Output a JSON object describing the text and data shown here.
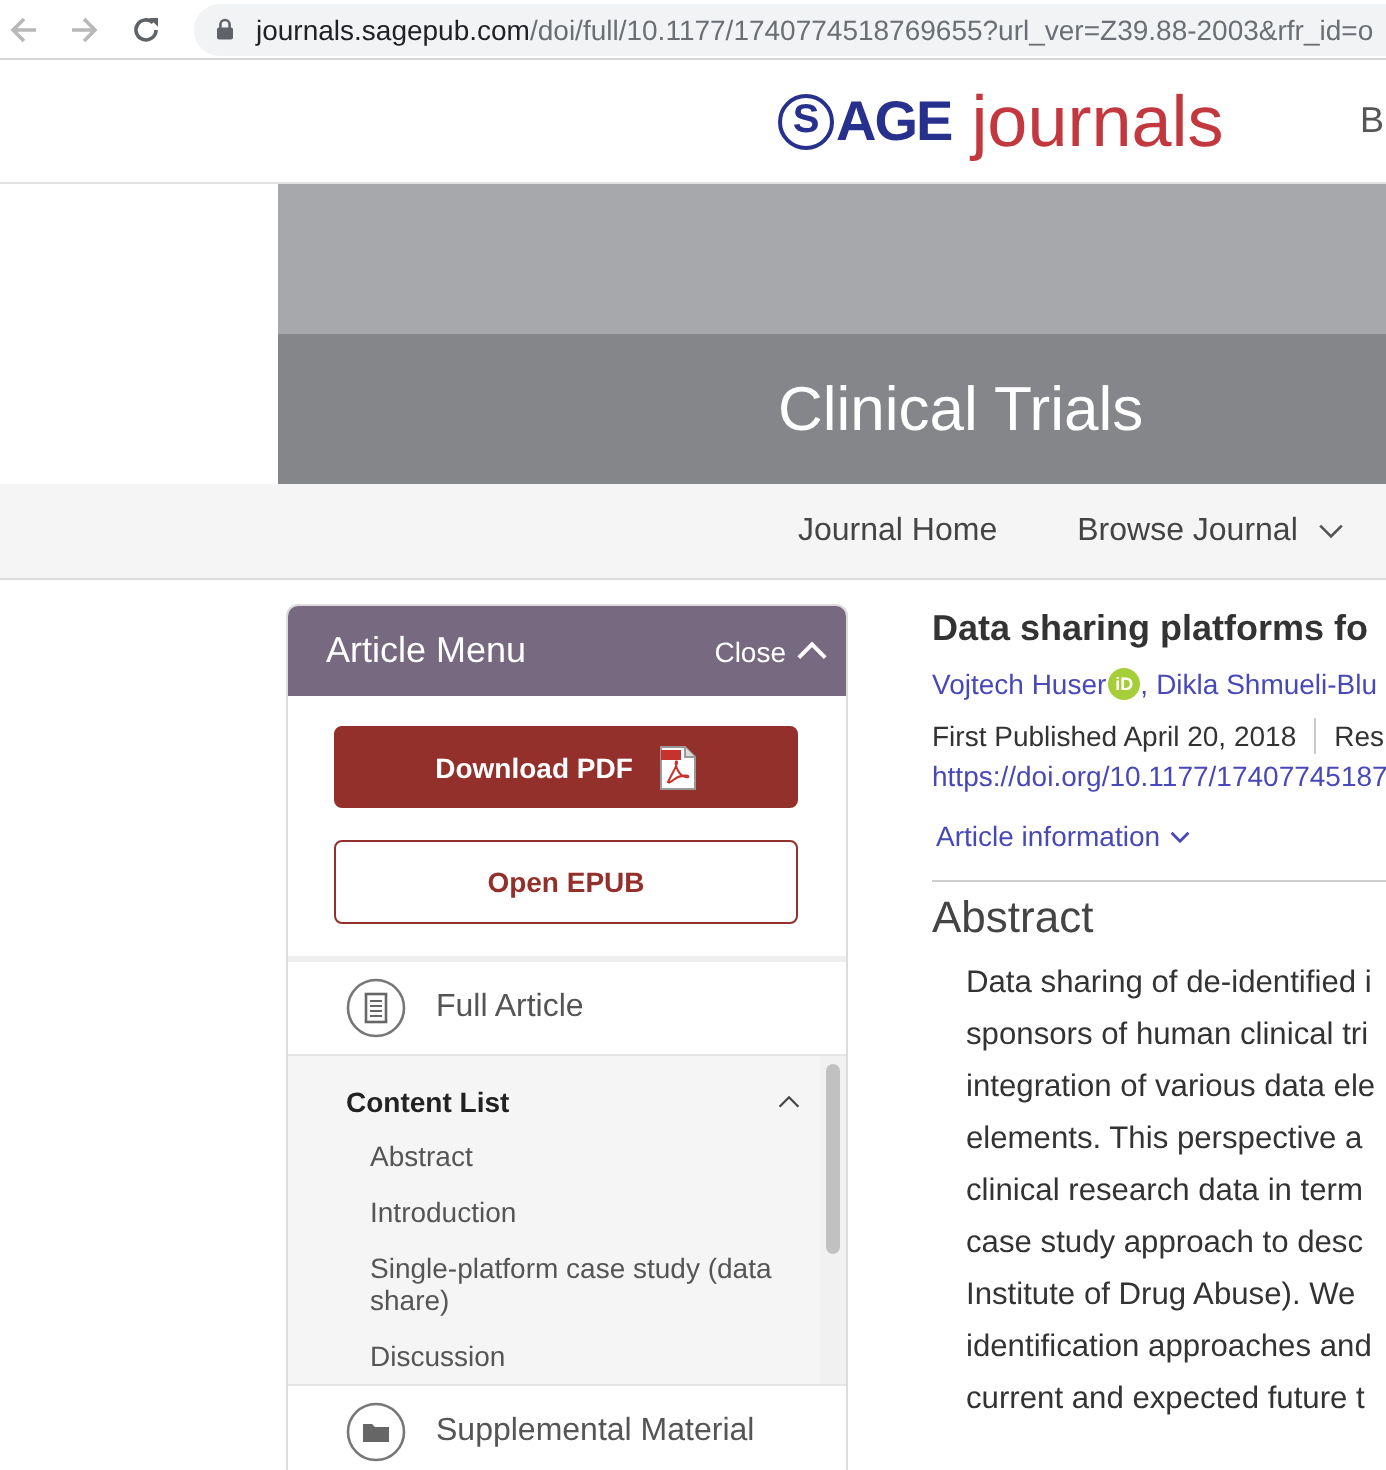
{
  "browser": {
    "back_disabled": true,
    "forward_disabled": true,
    "host": "journals.sagepub.com",
    "path": "/doi/full/10.1177/1740774518769655?url_ver=Z39.88-2003&rfr_id=o"
  },
  "header": {
    "logo": {
      "letter": "S",
      "rest": "AGE",
      "product": "journals"
    },
    "nav_cut": "B"
  },
  "banner": {
    "title": "Clinical Trials"
  },
  "journal_nav": [
    {
      "label": "Journal Home",
      "has_menu": false
    },
    {
      "label": "Browse Journal",
      "has_menu": true
    }
  ],
  "article_menu": {
    "title": "Article Menu",
    "close_label": "Close",
    "expanded": true,
    "buttons": [
      {
        "label": "Download PDF",
        "kind": "download"
      },
      {
        "label": "Open EPUB",
        "kind": "open"
      }
    ],
    "full_article": {
      "label": "Full Article"
    },
    "content_list": {
      "title": "Content List",
      "expanded": true,
      "items": [
        "Abstract",
        "Introduction",
        "Single-platform case study (data share)",
        "Discussion"
      ]
    },
    "supplemental": {
      "label": "Supplemental Material"
    }
  },
  "article": {
    "title": "Data sharing platforms fo",
    "authors": [
      {
        "name": "Vojtech Huser",
        "id_badge": "iD"
      },
      {
        "name": "Dikla Shmueli-Blu"
      }
    ],
    "author_separator": ",",
    "published": "First Published April 20, 2018",
    "published_next": "Res",
    "doi": "https://doi.org/10.1177/17407745187",
    "info_link": {
      "label": "Article information",
      "expanded": false
    },
    "abstract": {
      "heading": "Abstract",
      "lines": [
        "Data sharing of de-identified i",
        "sponsors of human clinical tri",
        "integration of various data ele",
        "elements. This perspective a",
        "clinical research data in term",
        "case study approach to desc",
        "Institute of Drug Abuse). We",
        "identification approaches and",
        "current and expected future t"
      ]
    }
  }
}
